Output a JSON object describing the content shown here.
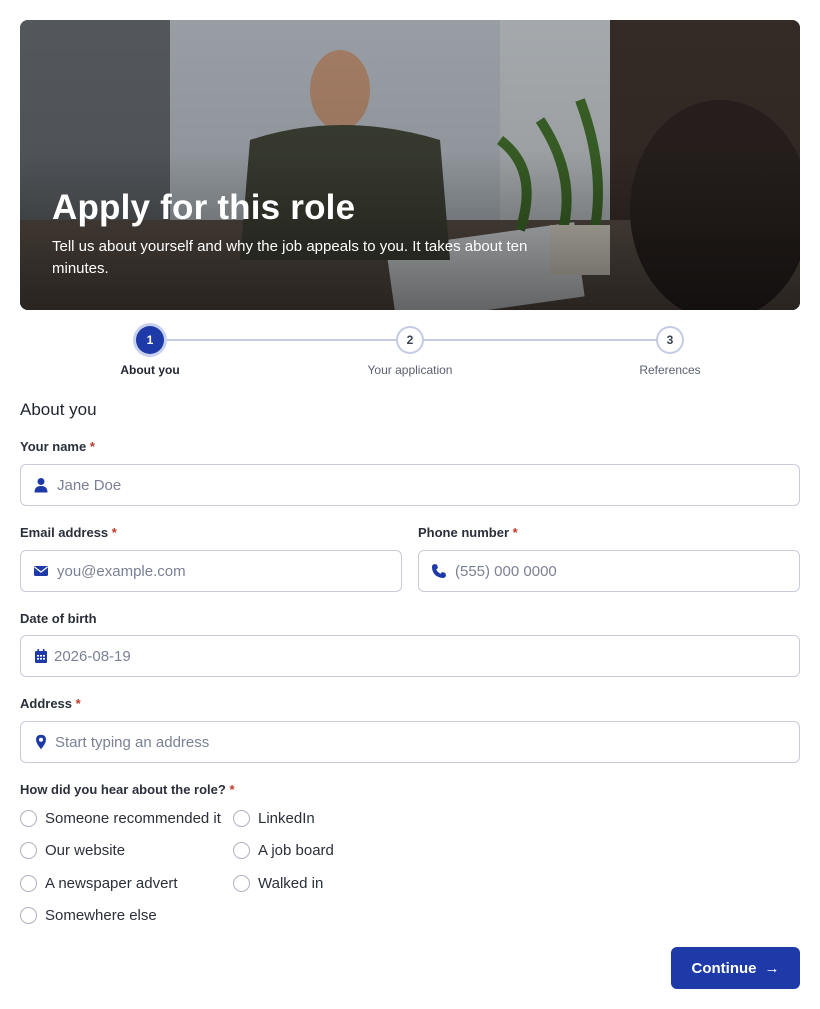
{
  "hero": {
    "title": "Apply for this role",
    "subtitle": "Tell us about yourself and why the job appeals to you. It takes about ten minutes."
  },
  "stepper": {
    "current_step": 1,
    "steps": [
      {
        "number": "1",
        "label": "About you"
      },
      {
        "number": "2",
        "label": "Your application"
      },
      {
        "number": "3",
        "label": "References"
      }
    ]
  },
  "section": {
    "title": "About you"
  },
  "form": {
    "name": {
      "label": "Your name",
      "required_mark": "*",
      "placeholder": "Jane Doe",
      "icon": "user-icon"
    },
    "email": {
      "label": "Email address",
      "required_mark": "*",
      "placeholder": "you@example.com",
      "icon": "envelope-icon"
    },
    "phone": {
      "label": "Phone number",
      "required_mark": "*",
      "placeholder": "(555) 000 0000",
      "icon": "phone-icon"
    },
    "dob": {
      "label": "Date of birth",
      "placeholder": "2026-08-19",
      "icon": "calendar-icon"
    },
    "address": {
      "label": "Address",
      "required_mark": "*",
      "placeholder": "Start typing an address",
      "icon": "map-pin-icon"
    },
    "heard": {
      "label": "How did you hear about the role?",
      "required_mark": "*",
      "options": [
        "Someone recommended it",
        "LinkedIn",
        "Our website",
        "A job board",
        "A newspaper advert",
        "Walked in",
        "Somewhere else"
      ]
    }
  },
  "actions": {
    "continue_label": "Continue",
    "continue_arrow": "→"
  },
  "colors": {
    "accent": "#1e3aa8",
    "required": "#c0392b",
    "border": "#c8cbd8"
  }
}
